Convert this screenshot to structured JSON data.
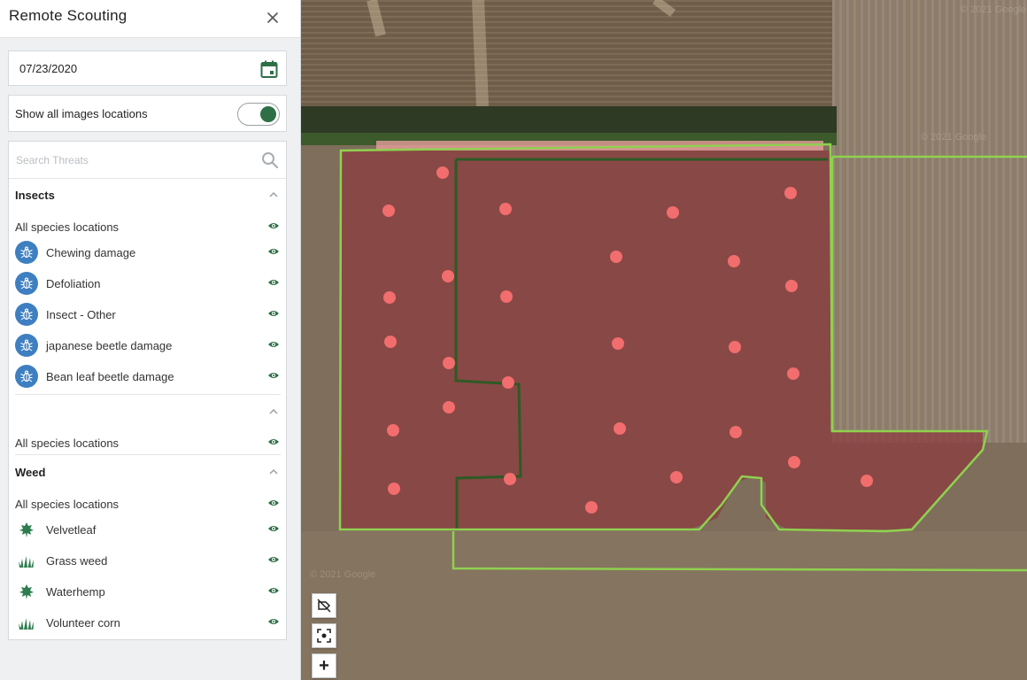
{
  "panel": {
    "title": "Remote Scouting",
    "date": "07/23/2020",
    "toggle": {
      "label": "Show all images locations",
      "on": true
    },
    "search_placeholder": "Search Threats"
  },
  "sections": [
    {
      "title": "Insects",
      "all_label": "All species locations",
      "items": [
        {
          "label": "Chewing damage",
          "icon": "insect-icon"
        },
        {
          "label": "Defoliation",
          "icon": "insect-icon"
        },
        {
          "label": "Insect - Other",
          "icon": "insect-icon"
        },
        {
          "label": "japanese beetle damage",
          "icon": "insect-icon"
        },
        {
          "label": "Bean leaf beetle damage",
          "icon": "insect-icon"
        }
      ]
    },
    {
      "title": "",
      "all_label": "All species locations",
      "items": []
    },
    {
      "title": "Weed",
      "all_label": "All species locations",
      "items": [
        {
          "label": "Velvetleaf",
          "icon": "broadleaf-weed-icon"
        },
        {
          "label": "Grass weed",
          "icon": "grass-weed-icon"
        },
        {
          "label": "Waterhemp",
          "icon": "broadleaf-weed-icon"
        },
        {
          "label": "Volunteer corn",
          "icon": "grass-weed-icon"
        }
      ]
    }
  ],
  "map": {
    "attribution_1": "© 2021 Google",
    "attribution_2": "© 2021 Google",
    "attribution_3": "© 2021 Google",
    "controls": [
      "hide-labels",
      "recenter",
      "zoom-in"
    ],
    "zoom_in_label": "+"
  },
  "colors": {
    "accent_green": "#2e6f46",
    "insect_blue": "#3e7fc1",
    "field_boundary": "#8fd14f",
    "marker": "#f26d6d"
  }
}
